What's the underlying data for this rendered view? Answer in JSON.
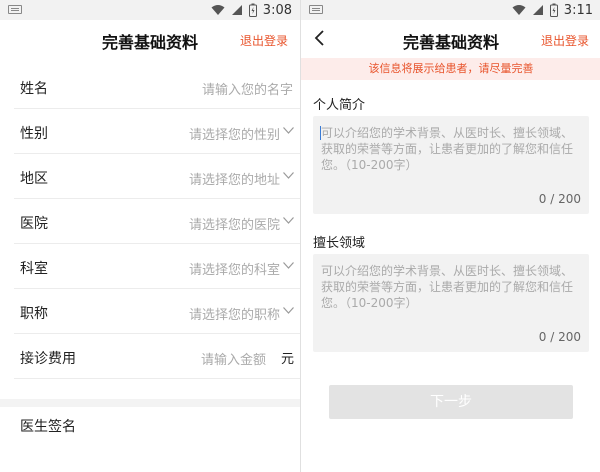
{
  "left": {
    "status": {
      "time": "3:08"
    },
    "header": {
      "title": "完善基础资料",
      "logout": "退出登录"
    },
    "fields": [
      {
        "label": "姓名",
        "placeholder": "请输入您的名字",
        "chevron": false
      },
      {
        "label": "性别",
        "placeholder": "请选择您的性别",
        "chevron": true
      },
      {
        "label": "地区",
        "placeholder": "请选择您的地址",
        "chevron": true
      },
      {
        "label": "医院",
        "placeholder": "请选择您的医院",
        "chevron": true
      },
      {
        "label": "科室",
        "placeholder": "请选择您的科室",
        "chevron": true
      },
      {
        "label": "职称",
        "placeholder": "请选择您的职称",
        "chevron": true
      }
    ],
    "fee": {
      "label": "接诊费用",
      "placeholder": "请输入金额",
      "unit": "元"
    },
    "signature_label": "医生签名"
  },
  "right": {
    "status": {
      "time": "3:11"
    },
    "header": {
      "title": "完善基础资料",
      "logout": "退出登录"
    },
    "notice": "该信息将展示给患者，请尽量完善",
    "intro": {
      "label": "个人简介",
      "placeholder": "可以介绍您的学术背景、从医时长、擅长领域、获取的荣誉等方面，让患者更加的了解您和信任您。（10-200字）",
      "count": "0 / 200"
    },
    "specialty": {
      "label": "擅长领域",
      "placeholder": "可以介绍您的学术背景、从医时长、擅长领域、获取的荣誉等方面，让患者更加的了解您和信任您。（10-200字）",
      "count": "0 / 200"
    },
    "next_label": "下一步"
  },
  "colors": {
    "accent": "#e8542c",
    "placeholder": "#aaaaaa",
    "field_bg": "#f2f2f2"
  },
  "icons": [
    "keyboard-icon",
    "wifi-icon",
    "signal-icon",
    "battery-icon",
    "chevron-down-icon",
    "back-arrow-icon"
  ]
}
